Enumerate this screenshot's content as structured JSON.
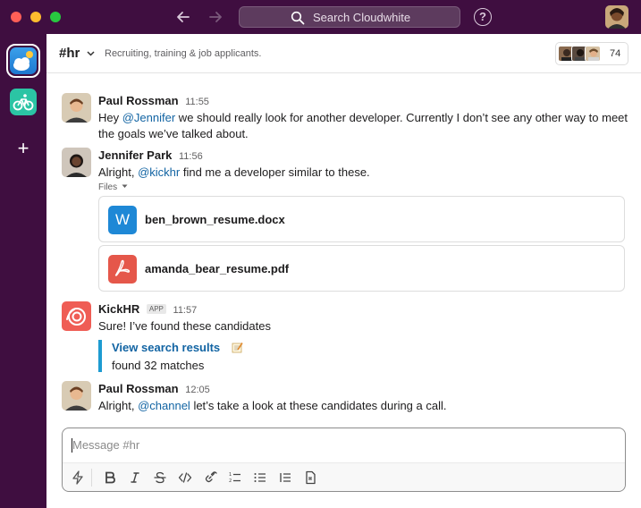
{
  "titlebar": {
    "search_placeholder": "Search Cloudwhite",
    "back_icon": "arrow-left-icon",
    "forward_icon": "arrow-right-icon",
    "help_icon": "question-circle-icon",
    "help_glyph": "?"
  },
  "rail": {
    "add_label": "+"
  },
  "channel": {
    "name": "#hr",
    "topic": "Recruiting, training & job applicants.",
    "member_count": "74"
  },
  "messages": [
    {
      "author": "Paul Rossman",
      "time": "11:55",
      "text_before": "Hey ",
      "mention": "@Jennifer",
      "text_after": " we should really look for another developer. Currently I don’t see any other way to meet the goals we’ve talked about."
    },
    {
      "author": "Jennifer Park",
      "time": "11:56",
      "text_before": "Alright, ",
      "mention": "@kickhr",
      "text_after": " find me a developer similar to these.",
      "files_label": "Files",
      "files": [
        {
          "name": "ben_brown_resume.docx",
          "icon_letter": "W",
          "icon": "word-doc-icon",
          "color": "#1e88d6"
        },
        {
          "name": "amanda_bear_resume.pdf",
          "icon": "pdf-icon",
          "color": "#e5574a"
        }
      ]
    },
    {
      "author": "KickHR",
      "badge": "APP",
      "time": "11:57",
      "text": "Sure! I’ve found these candidates",
      "attachment": {
        "link": "View search results",
        "detail": "found 32 matches"
      }
    },
    {
      "author": "Paul Rossman",
      "time": "12:05",
      "text_before": "Alright, ",
      "mention": "@channel",
      "text_after": " let’s take a look at these candidates during a call."
    }
  ],
  "composer": {
    "placeholder": "Message #hr",
    "tools": [
      "shortcuts",
      "bold",
      "italic",
      "strikethrough",
      "code",
      "link",
      "ordered-list",
      "bulleted-list",
      "numbered-block",
      "attachment"
    ]
  },
  "colors": {
    "sidebar": "#3f0e40",
    "mention": "#1264a3",
    "accent_bar": "#1d9bd1",
    "kickhr": "#ef5d55"
  }
}
